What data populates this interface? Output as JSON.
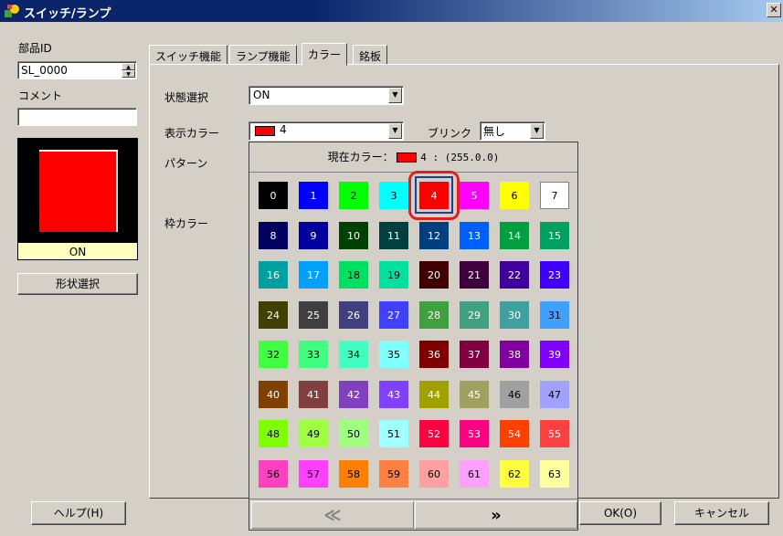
{
  "window": {
    "title": "スイッチ/ランプ",
    "close_label": "✕"
  },
  "left_panel": {
    "part_id_label": "部品ID",
    "part_id_value": "SL_0000",
    "comment_label": "コメント",
    "comment_value": "",
    "preview_state_label": "ON",
    "preview_color": "#ff0000",
    "shape_select_button": "形状選択"
  },
  "tabs": [
    {
      "label": "スイッチ機能",
      "active": false
    },
    {
      "label": "ランプ機能",
      "active": false
    },
    {
      "label": "カラー",
      "active": true
    },
    {
      "label": "銘板",
      "active": false
    }
  ],
  "form": {
    "state_label": "状態選択",
    "state_value": "ON",
    "display_color_label": "表示カラー",
    "display_color_value": "4",
    "blink_label": "ブリンク",
    "blink_value": "無し",
    "pattern_label": "パターン",
    "frame_color_label": "枠カラー"
  },
  "color_popup": {
    "current_label": "現在カラー：",
    "current_value": "4 : (255.0.0)",
    "selected_index": 4,
    "prev_label": "≪",
    "next_label": "»",
    "colors": [
      {
        "n": "0",
        "bg": "#000000",
        "fg": "#ffffff"
      },
      {
        "n": "1",
        "bg": "#0000ff",
        "fg": "#ffffff"
      },
      {
        "n": "2",
        "bg": "#00ff00",
        "fg": "#000000"
      },
      {
        "n": "3",
        "bg": "#00ffff",
        "fg": "#000000"
      },
      {
        "n": "4",
        "bg": "#ff0000",
        "fg": "#ffffff"
      },
      {
        "n": "5",
        "bg": "#ff00ff",
        "fg": "#ffffff"
      },
      {
        "n": "6",
        "bg": "#ffff00",
        "fg": "#000000"
      },
      {
        "n": "7",
        "bg": "#ffffff",
        "fg": "#000000"
      },
      {
        "n": "8",
        "bg": "#000060",
        "fg": "#ffffff"
      },
      {
        "n": "9",
        "bg": "#0000a0",
        "fg": "#ffffff"
      },
      {
        "n": "10",
        "bg": "#004000",
        "fg": "#ffffff"
      },
      {
        "n": "11",
        "bg": "#004040",
        "fg": "#ffffff"
      },
      {
        "n": "12",
        "bg": "#004080",
        "fg": "#ffffff"
      },
      {
        "n": "13",
        "bg": "#0060ff",
        "fg": "#ffffff"
      },
      {
        "n": "14",
        "bg": "#00a040",
        "fg": "#ffffff"
      },
      {
        "n": "15",
        "bg": "#00a060",
        "fg": "#ffffff"
      },
      {
        "n": "16",
        "bg": "#00a0a0",
        "fg": "#ffffff"
      },
      {
        "n": "17",
        "bg": "#00a0ff",
        "fg": "#ffffff"
      },
      {
        "n": "18",
        "bg": "#00e060",
        "fg": "#000000"
      },
      {
        "n": "19",
        "bg": "#00e0a0",
        "fg": "#000000"
      },
      {
        "n": "20",
        "bg": "#400000",
        "fg": "#ffffff"
      },
      {
        "n": "21",
        "bg": "#400040",
        "fg": "#ffffff"
      },
      {
        "n": "22",
        "bg": "#4000a0",
        "fg": "#ffffff"
      },
      {
        "n": "23",
        "bg": "#4000ff",
        "fg": "#ffffff"
      },
      {
        "n": "24",
        "bg": "#404000",
        "fg": "#ffffff"
      },
      {
        "n": "25",
        "bg": "#404040",
        "fg": "#ffffff"
      },
      {
        "n": "26",
        "bg": "#404080",
        "fg": "#ffffff"
      },
      {
        "n": "27",
        "bg": "#4040ff",
        "fg": "#ffffff"
      },
      {
        "n": "28",
        "bg": "#40a040",
        "fg": "#ffffff"
      },
      {
        "n": "29",
        "bg": "#40a080",
        "fg": "#ffffff"
      },
      {
        "n": "30",
        "bg": "#40a0a0",
        "fg": "#ffffff"
      },
      {
        "n": "31",
        "bg": "#40a0ff",
        "fg": "#000000"
      },
      {
        "n": "32",
        "bg": "#40ff40",
        "fg": "#000000"
      },
      {
        "n": "33",
        "bg": "#40ff80",
        "fg": "#000000"
      },
      {
        "n": "34",
        "bg": "#40ffc0",
        "fg": "#000000"
      },
      {
        "n": "35",
        "bg": "#80ffff",
        "fg": "#000000"
      },
      {
        "n": "36",
        "bg": "#800000",
        "fg": "#ffffff"
      },
      {
        "n": "37",
        "bg": "#800040",
        "fg": "#ffffff"
      },
      {
        "n": "38",
        "bg": "#8000a0",
        "fg": "#ffffff"
      },
      {
        "n": "39",
        "bg": "#8000ff",
        "fg": "#ffffff"
      },
      {
        "n": "40",
        "bg": "#804000",
        "fg": "#ffffff"
      },
      {
        "n": "41",
        "bg": "#804040",
        "fg": "#ffffff"
      },
      {
        "n": "42",
        "bg": "#8040c0",
        "fg": "#ffffff"
      },
      {
        "n": "43",
        "bg": "#8040ff",
        "fg": "#ffffff"
      },
      {
        "n": "44",
        "bg": "#a0a000",
        "fg": "#ffffff"
      },
      {
        "n": "45",
        "bg": "#a0a060",
        "fg": "#ffffff"
      },
      {
        "n": "46",
        "bg": "#a0a0a0",
        "fg": "#000000"
      },
      {
        "n": "47",
        "bg": "#a0a0ff",
        "fg": "#000000"
      },
      {
        "n": "48",
        "bg": "#80ff00",
        "fg": "#000000"
      },
      {
        "n": "49",
        "bg": "#a0ff40",
        "fg": "#000000"
      },
      {
        "n": "50",
        "bg": "#a0ff80",
        "fg": "#000000"
      },
      {
        "n": "51",
        "bg": "#a0ffff",
        "fg": "#000000"
      },
      {
        "n": "52",
        "bg": "#ff0040",
        "fg": "#ffffff"
      },
      {
        "n": "53",
        "bg": "#ff0080",
        "fg": "#ffffff"
      },
      {
        "n": "54",
        "bg": "#ff4000",
        "fg": "#ffffff"
      },
      {
        "n": "55",
        "bg": "#ff4040",
        "fg": "#ffffff"
      },
      {
        "n": "56",
        "bg": "#ff40c0",
        "fg": "#000000"
      },
      {
        "n": "57",
        "bg": "#ff40ff",
        "fg": "#000000"
      },
      {
        "n": "58",
        "bg": "#ff8000",
        "fg": "#000000"
      },
      {
        "n": "59",
        "bg": "#ff8040",
        "fg": "#000000"
      },
      {
        "n": "60",
        "bg": "#ffa0a0",
        "fg": "#000000"
      },
      {
        "n": "61",
        "bg": "#ffa0ff",
        "fg": "#000000"
      },
      {
        "n": "62",
        "bg": "#ffff40",
        "fg": "#000000"
      },
      {
        "n": "63",
        "bg": "#ffffa0",
        "fg": "#000000"
      }
    ]
  },
  "footer": {
    "help_button": "ヘルプ(H)",
    "ok_button": "OK(O)",
    "cancel_button": "キャンセル"
  }
}
